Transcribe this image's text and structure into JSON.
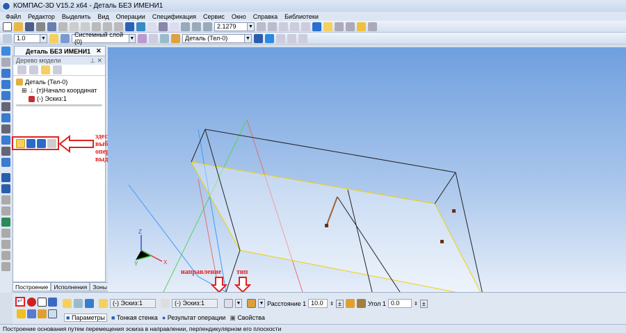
{
  "title": "КОМПАС-3D V15.2  x64 - Деталь БЕЗ ИМЕНИ1",
  "menu": [
    "Файл",
    "Редактор",
    "Выделить",
    "Вид",
    "Операции",
    "Спецификация",
    "Сервис",
    "Окно",
    "Справка",
    "Библиотеки"
  ],
  "toolbar1": {
    "zoom_value": "2.1279"
  },
  "toolbar2": {
    "step_value": "1.0",
    "layer": "Системный слой (0)",
    "body": "Деталь (Тел-0)"
  },
  "doc_tab": "Деталь БЕЗ ИМЕНИ1",
  "tree": {
    "header": "Дерево модели",
    "items": [
      "Деталь (Тел-0)",
      "(т)Начало координат",
      "(-) Эскиз:1"
    ]
  },
  "bottom_tabs": [
    "Построение",
    "Исполнения",
    "Зоны"
  ],
  "annotation": {
    "line1": "здесь",
    "line2": "выбирается",
    "line3": "операция",
    "line4": "выдавливания",
    "direction_label": "направление",
    "type_label": "тип"
  },
  "prop": {
    "sketch1": "(-) Эскиз:1",
    "sketch2": "(-) Эскиз:1",
    "distance_label": "Расстояние 1",
    "distance_value": "10.0",
    "angle_label": "Угол 1",
    "angle_value": "0.0",
    "tabs": [
      "Параметры",
      "Тонкая стенка",
      "Результат операции",
      "Свойства"
    ]
  },
  "status": "Построение основания путем перемещения эскиза в направлении, перпендикулярном его плоскости",
  "axes": {
    "x": "X",
    "y": "Y",
    "z": "Z"
  }
}
